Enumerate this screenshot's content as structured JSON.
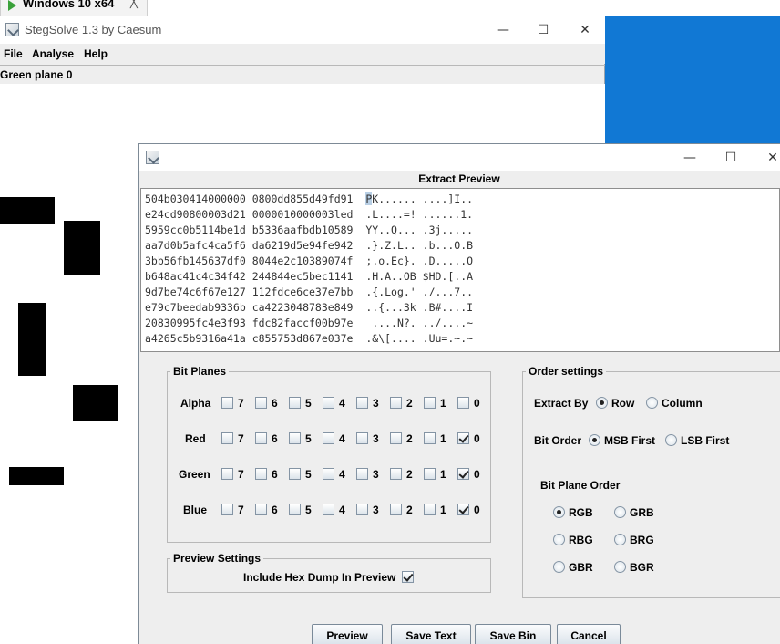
{
  "vm_tab": {
    "title": "Windows 10 x64",
    "close_glyph": "╳"
  },
  "main_window": {
    "title": "StegSolve 1.3 by Caesum",
    "menu": [
      "File",
      "Analyse",
      "Help"
    ],
    "plane_label": "Green plane 0",
    "controls": {
      "minimize": "—",
      "maximize": "☐",
      "close": "✕"
    }
  },
  "dialog": {
    "title": "",
    "heading": "Extract Preview",
    "controls": {
      "minimize": "—",
      "maximize": "☐",
      "close": "✕"
    },
    "preview_lines": [
      {
        "hex": "504b030414000000 0800dd855d49fd91",
        "ascii": "PK...... ....]I.."
      },
      {
        "hex": "e24cd90800003d21 0000010000003led",
        "ascii": ".L....=! ......1."
      },
      {
        "hex": "5959cc0b5114be1d b5336aafbdb10589",
        "ascii": "YY..Q... .3j....."
      },
      {
        "hex": "aa7d0b5afc4ca5f6 da6219d5e94fe942",
        "ascii": ".}.Z.L.. .b...O.B"
      },
      {
        "hex": "3bb56fb145637df0 8044e2c10389074f",
        "ascii": ";.o.Ec}. .D.....O"
      },
      {
        "hex": "b648ac41c4c34f42 244844ec5bec1141",
        "ascii": ".H.A..OB $HD.[..A"
      },
      {
        "hex": "9d7be74c6f67e127 112fdce6ce37e7bb",
        "ascii": ".{.Log.' ./...7.."
      },
      {
        "hex": "e79c7beedab9336b ca4223048783e849",
        "ascii": "..{...3k .B#....I"
      },
      {
        "hex": "20830995fc4e3f93 fdc82faccf00b97e",
        "ascii": " ....N?. ../....~"
      },
      {
        "hex": "a4265c5b9316a41a c855753d867e037e",
        "ascii": ".&\\[.... .Uu=.~.~"
      }
    ],
    "bit_planes": {
      "legend": "Bit Planes",
      "bits": [
        "7",
        "6",
        "5",
        "4",
        "3",
        "2",
        "1",
        "0"
      ],
      "rows": [
        {
          "label": "Alpha",
          "checked": [
            false,
            false,
            false,
            false,
            false,
            false,
            false,
            false
          ]
        },
        {
          "label": "Red",
          "checked": [
            false,
            false,
            false,
            false,
            false,
            false,
            false,
            true
          ]
        },
        {
          "label": "Green",
          "checked": [
            false,
            false,
            false,
            false,
            false,
            false,
            false,
            true
          ]
        },
        {
          "label": "Blue",
          "checked": [
            false,
            false,
            false,
            false,
            false,
            false,
            false,
            true
          ]
        }
      ]
    },
    "order_settings": {
      "legend": "Order settings",
      "extract_by": {
        "label": "Extract By",
        "options": [
          "Row",
          "Column"
        ],
        "selected": "Row"
      },
      "bit_order": {
        "label": "Bit Order",
        "options": [
          "MSB First",
          "LSB First"
        ],
        "selected": "MSB First"
      },
      "plane_order": {
        "label": "Bit Plane Order",
        "options": [
          "RGB",
          "GRB",
          "RBG",
          "BRG",
          "GBR",
          "BGR"
        ],
        "selected": "RGB"
      }
    },
    "preview_settings": {
      "legend": "Preview Settings",
      "hex_dump_label": "Include Hex Dump In Preview",
      "hex_dump_checked": true
    },
    "buttons": {
      "preview": "Preview",
      "save_text": "Save Text",
      "save_bin": "Save Bin",
      "cancel": "Cancel"
    }
  }
}
